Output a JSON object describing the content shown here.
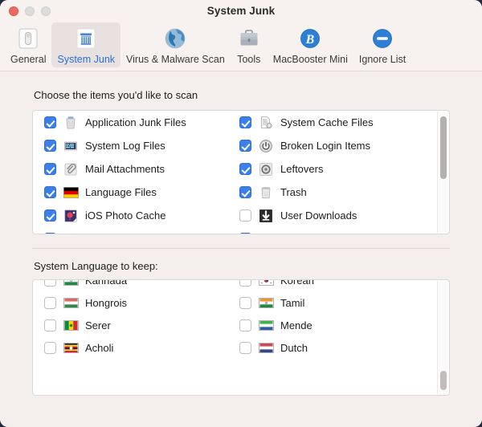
{
  "window": {
    "title": "System Junk",
    "traffic_lights": [
      "close",
      "minimize",
      "maximize"
    ]
  },
  "toolbar": {
    "tabs": [
      {
        "label": "General",
        "icon": "drive-icon",
        "selected": false
      },
      {
        "label": "System Junk",
        "icon": "broom-icon",
        "selected": true
      },
      {
        "label": "Virus & Malware Scan",
        "icon": "globe-icon",
        "selected": false
      },
      {
        "label": "Tools",
        "icon": "toolbox-icon",
        "selected": false
      },
      {
        "label": "MacBooster Mini",
        "icon": "macbooster-b-icon",
        "selected": false
      },
      {
        "label": "Ignore List",
        "icon": "no-entry-icon",
        "selected": false
      }
    ]
  },
  "scan_section": {
    "label": "Choose the items you'd like to scan",
    "left_column": [
      {
        "label": "Application Junk Files",
        "icon": "trash-can-icon",
        "checked": true
      },
      {
        "label": "System Log Files",
        "icon": "log-file-icon",
        "checked": true
      },
      {
        "label": "Mail Attachments",
        "icon": "paperclip-icon",
        "checked": true
      },
      {
        "label": "Language Files",
        "icon": "german-flag-icon",
        "checked": true
      },
      {
        "label": "iOS Photo Cache",
        "icon": "photo-icon",
        "checked": true
      }
    ],
    "right_column": [
      {
        "label": "System Cache Files",
        "icon": "document-gear-icon",
        "checked": true
      },
      {
        "label": "Broken Login Items",
        "icon": "power-icon",
        "checked": true
      },
      {
        "label": "Leftovers",
        "icon": "disc-gear-icon",
        "checked": true
      },
      {
        "label": "Trash",
        "icon": "trash-can-icon",
        "checked": true
      },
      {
        "label": "User Downloads",
        "icon": "download-icon",
        "checked": false
      }
    ]
  },
  "language_section": {
    "label": "System Language to keep:",
    "left_column": [
      {
        "label": "Kannada",
        "icon": "india-flag-icon",
        "checked": false,
        "clipped": true
      },
      {
        "label": "Hongrois",
        "icon": "hungary-flag-icon",
        "checked": false
      },
      {
        "label": "Serer",
        "icon": "senegal-flag-icon",
        "checked": false
      },
      {
        "label": "Acholi",
        "icon": "uganda-flag-icon",
        "checked": false
      }
    ],
    "right_column": [
      {
        "label": "Korean",
        "icon": "korea-flag-icon",
        "checked": false,
        "clipped": true
      },
      {
        "label": "Tamil",
        "icon": "india-flag-icon",
        "checked": false
      },
      {
        "label": "Mende",
        "icon": "sierraleone-flag-icon",
        "checked": false
      },
      {
        "label": "Dutch",
        "icon": "netherlands-flag-icon",
        "checked": false
      }
    ]
  },
  "colors": {
    "window_bg": "#f4eeed",
    "toolbar_bg": "#f7f1f0",
    "accent_blue": "#3b7fe8",
    "selected_tab_text": "#2a6fd6",
    "close_light": "#ec6a5e"
  }
}
